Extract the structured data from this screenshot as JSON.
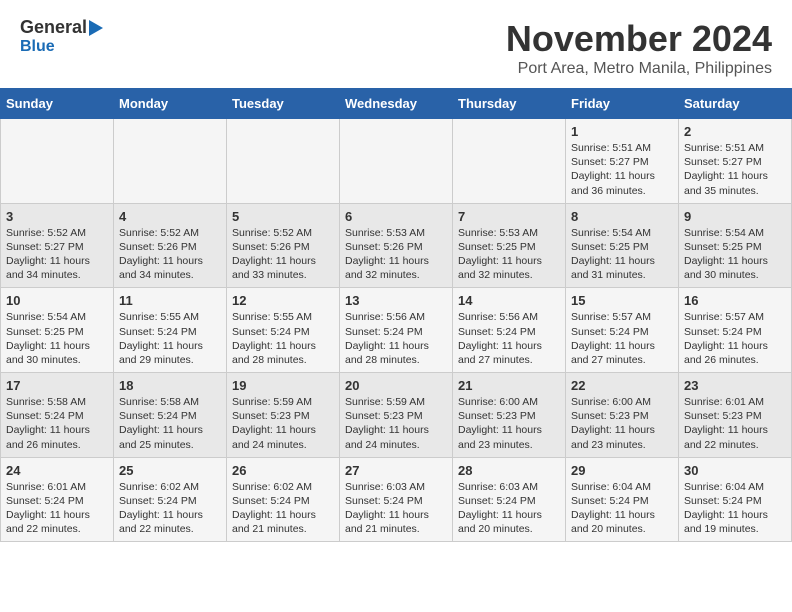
{
  "header": {
    "logo_line1": "General",
    "logo_line2": "Blue",
    "title": "November 2024",
    "subtitle": "Port Area, Metro Manila, Philippines"
  },
  "calendar": {
    "weekdays": [
      "Sunday",
      "Monday",
      "Tuesday",
      "Wednesday",
      "Thursday",
      "Friday",
      "Saturday"
    ],
    "weeks": [
      [
        {
          "day": "",
          "info": ""
        },
        {
          "day": "",
          "info": ""
        },
        {
          "day": "",
          "info": ""
        },
        {
          "day": "",
          "info": ""
        },
        {
          "day": "",
          "info": ""
        },
        {
          "day": "1",
          "info": "Sunrise: 5:51 AM\nSunset: 5:27 PM\nDaylight: 11 hours and 36 minutes."
        },
        {
          "day": "2",
          "info": "Sunrise: 5:51 AM\nSunset: 5:27 PM\nDaylight: 11 hours and 35 minutes."
        }
      ],
      [
        {
          "day": "3",
          "info": "Sunrise: 5:52 AM\nSunset: 5:27 PM\nDaylight: 11 hours and 34 minutes."
        },
        {
          "day": "4",
          "info": "Sunrise: 5:52 AM\nSunset: 5:26 PM\nDaylight: 11 hours and 34 minutes."
        },
        {
          "day": "5",
          "info": "Sunrise: 5:52 AM\nSunset: 5:26 PM\nDaylight: 11 hours and 33 minutes."
        },
        {
          "day": "6",
          "info": "Sunrise: 5:53 AM\nSunset: 5:26 PM\nDaylight: 11 hours and 32 minutes."
        },
        {
          "day": "7",
          "info": "Sunrise: 5:53 AM\nSunset: 5:25 PM\nDaylight: 11 hours and 32 minutes."
        },
        {
          "day": "8",
          "info": "Sunrise: 5:54 AM\nSunset: 5:25 PM\nDaylight: 11 hours and 31 minutes."
        },
        {
          "day": "9",
          "info": "Sunrise: 5:54 AM\nSunset: 5:25 PM\nDaylight: 11 hours and 30 minutes."
        }
      ],
      [
        {
          "day": "10",
          "info": "Sunrise: 5:54 AM\nSunset: 5:25 PM\nDaylight: 11 hours and 30 minutes."
        },
        {
          "day": "11",
          "info": "Sunrise: 5:55 AM\nSunset: 5:24 PM\nDaylight: 11 hours and 29 minutes."
        },
        {
          "day": "12",
          "info": "Sunrise: 5:55 AM\nSunset: 5:24 PM\nDaylight: 11 hours and 28 minutes."
        },
        {
          "day": "13",
          "info": "Sunrise: 5:56 AM\nSunset: 5:24 PM\nDaylight: 11 hours and 28 minutes."
        },
        {
          "day": "14",
          "info": "Sunrise: 5:56 AM\nSunset: 5:24 PM\nDaylight: 11 hours and 27 minutes."
        },
        {
          "day": "15",
          "info": "Sunrise: 5:57 AM\nSunset: 5:24 PM\nDaylight: 11 hours and 27 minutes."
        },
        {
          "day": "16",
          "info": "Sunrise: 5:57 AM\nSunset: 5:24 PM\nDaylight: 11 hours and 26 minutes."
        }
      ],
      [
        {
          "day": "17",
          "info": "Sunrise: 5:58 AM\nSunset: 5:24 PM\nDaylight: 11 hours and 26 minutes."
        },
        {
          "day": "18",
          "info": "Sunrise: 5:58 AM\nSunset: 5:24 PM\nDaylight: 11 hours and 25 minutes."
        },
        {
          "day": "19",
          "info": "Sunrise: 5:59 AM\nSunset: 5:23 PM\nDaylight: 11 hours and 24 minutes."
        },
        {
          "day": "20",
          "info": "Sunrise: 5:59 AM\nSunset: 5:23 PM\nDaylight: 11 hours and 24 minutes."
        },
        {
          "day": "21",
          "info": "Sunrise: 6:00 AM\nSunset: 5:23 PM\nDaylight: 11 hours and 23 minutes."
        },
        {
          "day": "22",
          "info": "Sunrise: 6:00 AM\nSunset: 5:23 PM\nDaylight: 11 hours and 23 minutes."
        },
        {
          "day": "23",
          "info": "Sunrise: 6:01 AM\nSunset: 5:23 PM\nDaylight: 11 hours and 22 minutes."
        }
      ],
      [
        {
          "day": "24",
          "info": "Sunrise: 6:01 AM\nSunset: 5:24 PM\nDaylight: 11 hours and 22 minutes."
        },
        {
          "day": "25",
          "info": "Sunrise: 6:02 AM\nSunset: 5:24 PM\nDaylight: 11 hours and 22 minutes."
        },
        {
          "day": "26",
          "info": "Sunrise: 6:02 AM\nSunset: 5:24 PM\nDaylight: 11 hours and 21 minutes."
        },
        {
          "day": "27",
          "info": "Sunrise: 6:03 AM\nSunset: 5:24 PM\nDaylight: 11 hours and 21 minutes."
        },
        {
          "day": "28",
          "info": "Sunrise: 6:03 AM\nSunset: 5:24 PM\nDaylight: 11 hours and 20 minutes."
        },
        {
          "day": "29",
          "info": "Sunrise: 6:04 AM\nSunset: 5:24 PM\nDaylight: 11 hours and 20 minutes."
        },
        {
          "day": "30",
          "info": "Sunrise: 6:04 AM\nSunset: 5:24 PM\nDaylight: 11 hours and 19 minutes."
        }
      ]
    ]
  }
}
